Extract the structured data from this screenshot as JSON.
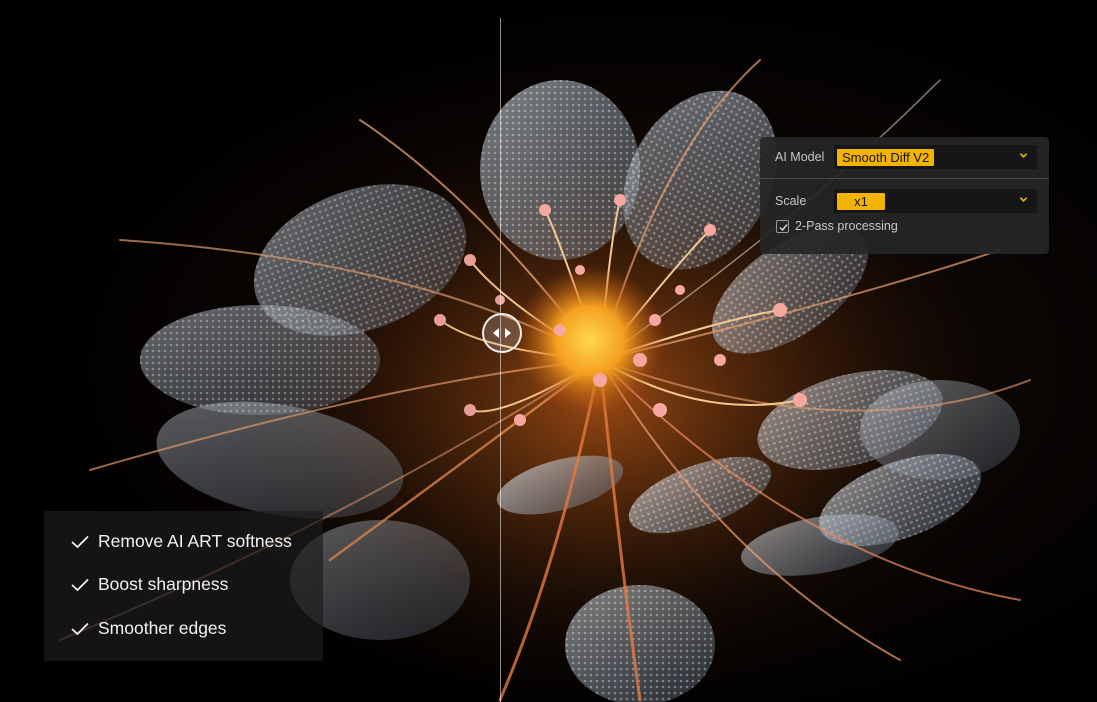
{
  "settings": {
    "model_label": "AI Model",
    "model_value": "Smooth Diff V2",
    "scale_label": "Scale",
    "scale_value": "x1",
    "two_pass_label": "2-Pass processing",
    "two_pass_checked": true
  },
  "features": [
    {
      "label": "Remove AI ART softness"
    },
    {
      "label": "Boost sharpness"
    },
    {
      "label": "Smoother edges"
    }
  ],
  "icons": {
    "dropdown": "chevron-down-icon",
    "check": "check-icon",
    "slider_handle": "left-right-arrows-icon"
  },
  "colors": {
    "accent": "#f3b400",
    "panel_bg": "#262626",
    "select_bg": "#161616"
  },
  "comparison": {
    "split_position": 0.457
  }
}
